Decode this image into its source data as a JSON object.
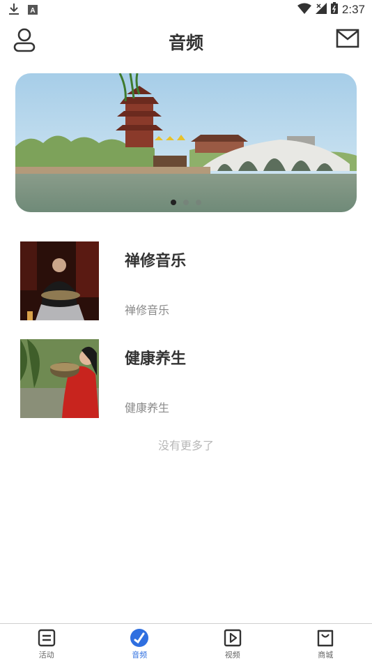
{
  "status_bar": {
    "time": "2:37",
    "icons": [
      "download-icon",
      "a-box-icon",
      "wifi-icon",
      "signal-icon",
      "battery-icon"
    ]
  },
  "header": {
    "title": "音频",
    "left_icon": "user-icon",
    "right_icon": "mail-icon"
  },
  "banner": {
    "page_count": 3,
    "active_page": 1
  },
  "list": {
    "items": [
      {
        "title": "禅修音乐",
        "subtitle": "禅修音乐"
      },
      {
        "title": "健康养生",
        "subtitle": "健康养生"
      }
    ],
    "end_text": "没有更多了"
  },
  "tabs": [
    {
      "label": "活动",
      "icon": "list-icon",
      "active": false
    },
    {
      "label": "音频",
      "icon": "audio-check-icon",
      "active": true
    },
    {
      "label": "视频",
      "icon": "play-icon",
      "active": false
    },
    {
      "label": "商城",
      "icon": "shopping-bag-icon",
      "active": false
    }
  ],
  "colors": {
    "accent": "#2f6fe0",
    "text": "#333333",
    "muted": "#8a8a8a"
  }
}
